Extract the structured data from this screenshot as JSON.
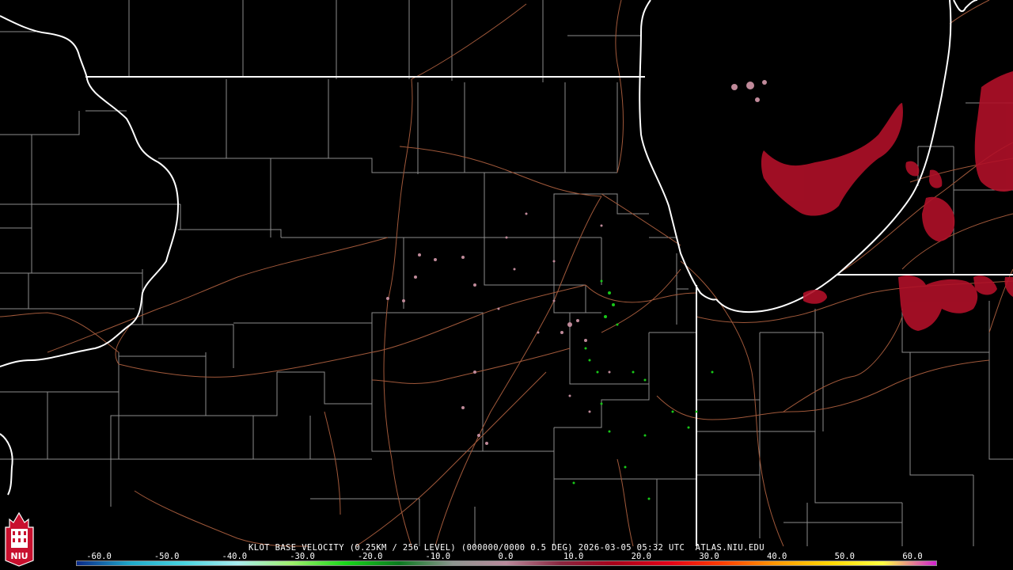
{
  "product": {
    "caption": "KLOT BASE VELOCITY (0.25KM / 256 LEVEL) (000000/0000 0.5 DEG) 2026-03-05 05:32 UTC  ATLAS.NIU.EDU"
  },
  "scale": {
    "labels": [
      "-60.0",
      "-50.0",
      "-40.0",
      "-30.0",
      "-20.0",
      "-10.0",
      "0.0",
      "10.0",
      "20.0",
      "30.0",
      "40.0",
      "50.0",
      "60.0"
    ],
    "colors": [
      "#0a2a8a",
      "#1fa9c9",
      "#48d4e0",
      "#a8ecef",
      "#9ff06b",
      "#18d81a",
      "#0a7a1f",
      "#8d958f",
      "#b9899b",
      "#8a2640",
      "#a8001a",
      "#e30019",
      "#ff3d00",
      "#ff9800",
      "#ffd600",
      "#ffff40",
      "#d020d0"
    ]
  },
  "logo": {
    "text": "NIU",
    "color": "#c8102e"
  },
  "colors": {
    "state_border": "#ffffff",
    "county_border": "#8c8c8c",
    "roads": "#a0583a",
    "inbound": "#18c818",
    "outbound": "#b01028",
    "clutter": "#c08a9a"
  }
}
